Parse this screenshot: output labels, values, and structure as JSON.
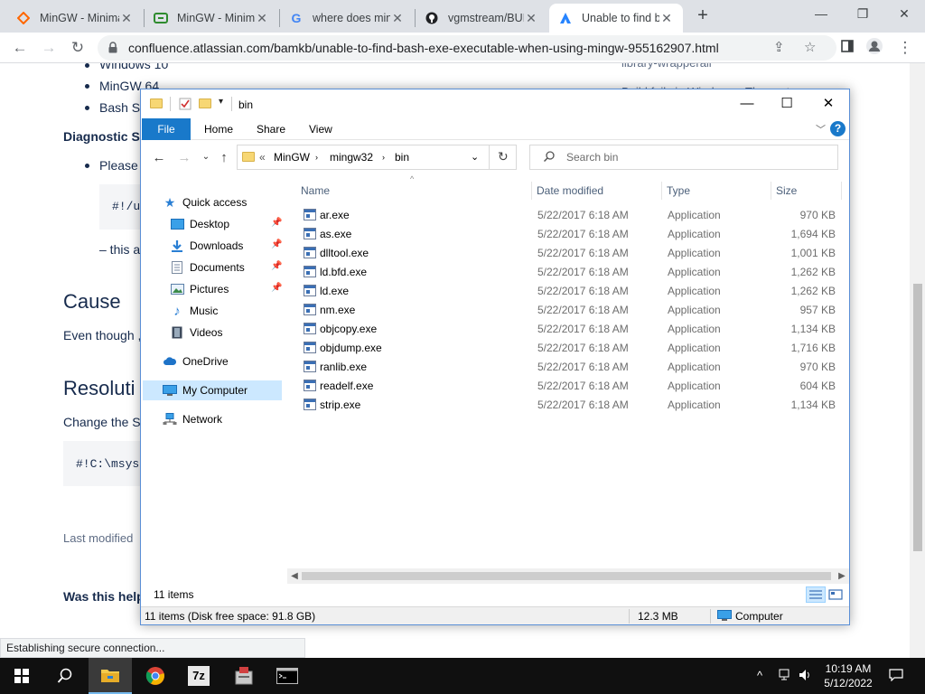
{
  "browser": {
    "tabs": [
      {
        "title": "MinGW - Minimalist GNU for Windows",
        "icon": "sourceforge-icon",
        "active": false
      },
      {
        "title": "MinGW - Minimalist GNU",
        "icon": "mingw-icon",
        "active": false
      },
      {
        "title": "where does mingw install",
        "icon": "google-icon",
        "active": false
      },
      {
        "title": "vgmstream/BUILD.md",
        "icon": "github-icon",
        "active": false
      },
      {
        "title": "Unable to find bash.exe",
        "icon": "atlassian-icon",
        "active": true
      }
    ],
    "new_tab_label": "+",
    "url": "confluence.atlassian.com/bamkb/unable-to-find-bash-exe-executable-when-using-mingw-955162907.html",
    "status_text": "Establishing secure connection..."
  },
  "webpage": {
    "bullets": [
      "Windows 10",
      "MinGW 64",
      "Bash Sc"
    ],
    "diagnostic_heading": "Diagnostic St",
    "please_text": "Please c",
    "code1": "#!/u",
    "this_text": "– this a",
    "cause_heading": "Cause",
    "even_text": "Even though ,",
    "resolution_heading": "Resoluti",
    "change_text": "Change the Sh",
    "code2": "#!C:\\msys",
    "last_modified": "Last modified",
    "was_helpful": "Was this help",
    "side_text1": "library-wrapperall",
    "side_text2": "Build fails in Windows - The system"
  },
  "explorer": {
    "title": "bin",
    "ribbon_tabs": [
      "File",
      "Home",
      "Share",
      "View"
    ],
    "help_label": "?",
    "breadcrumb": [
      "MinGW",
      "mingw32",
      "bin"
    ],
    "breadcrumb_prefix": "«",
    "search_placeholder": "Search bin",
    "nav": [
      {
        "label": "Quick access",
        "icon": "star-icon"
      },
      {
        "label": "Desktop",
        "icon": "desktop-icon",
        "pinned": true
      },
      {
        "label": "Downloads",
        "icon": "download-icon",
        "pinned": true
      },
      {
        "label": "Documents",
        "icon": "documents-icon",
        "pinned": true
      },
      {
        "label": "Pictures",
        "icon": "pictures-icon",
        "pinned": true
      },
      {
        "label": "Music",
        "icon": "music-icon"
      },
      {
        "label": "Videos",
        "icon": "videos-icon"
      },
      {
        "label": "OneDrive",
        "icon": "cloud-icon"
      },
      {
        "label": "My Computer",
        "icon": "computer-icon",
        "selected": true
      },
      {
        "label": "Network",
        "icon": "network-icon"
      }
    ],
    "columns": {
      "name": "Name",
      "date": "Date modified",
      "type": "Type",
      "size": "Size"
    },
    "files": [
      {
        "name": "ar.exe",
        "date": "5/22/2017 6:18 AM",
        "type": "Application",
        "size": "970 KB"
      },
      {
        "name": "as.exe",
        "date": "5/22/2017 6:18 AM",
        "type": "Application",
        "size": "1,694 KB"
      },
      {
        "name": "dlltool.exe",
        "date": "5/22/2017 6:18 AM",
        "type": "Application",
        "size": "1,001 KB"
      },
      {
        "name": "ld.bfd.exe",
        "date": "5/22/2017 6:18 AM",
        "type": "Application",
        "size": "1,262 KB"
      },
      {
        "name": "ld.exe",
        "date": "5/22/2017 6:18 AM",
        "type": "Application",
        "size": "1,262 KB"
      },
      {
        "name": "nm.exe",
        "date": "5/22/2017 6:18 AM",
        "type": "Application",
        "size": "957 KB"
      },
      {
        "name": "objcopy.exe",
        "date": "5/22/2017 6:18 AM",
        "type": "Application",
        "size": "1,134 KB"
      },
      {
        "name": "objdump.exe",
        "date": "5/22/2017 6:18 AM",
        "type": "Application",
        "size": "1,716 KB"
      },
      {
        "name": "ranlib.exe",
        "date": "5/22/2017 6:18 AM",
        "type": "Application",
        "size": "970 KB"
      },
      {
        "name": "readelf.exe",
        "date": "5/22/2017 6:18 AM",
        "type": "Application",
        "size": "604 KB"
      },
      {
        "name": "strip.exe",
        "date": "5/22/2017 6:18 AM",
        "type": "Application",
        "size": "1,134 KB"
      }
    ],
    "item_count": "11 items",
    "status": {
      "items_free": "11 items (Disk free space: 91.8 GB)",
      "size": "12.3 MB",
      "location": "Computer"
    }
  },
  "taskbar": {
    "time": "10:19 AM",
    "date": "5/12/2022",
    "apps": [
      "start-icon",
      "search-icon",
      "file-explorer-icon",
      "chrome-icon",
      "7zip-icon",
      "installer-icon",
      "terminal-icon"
    ]
  },
  "colors": {
    "accent": "#1979ca",
    "selection": "#cce8ff",
    "taskbar": "#101010"
  }
}
